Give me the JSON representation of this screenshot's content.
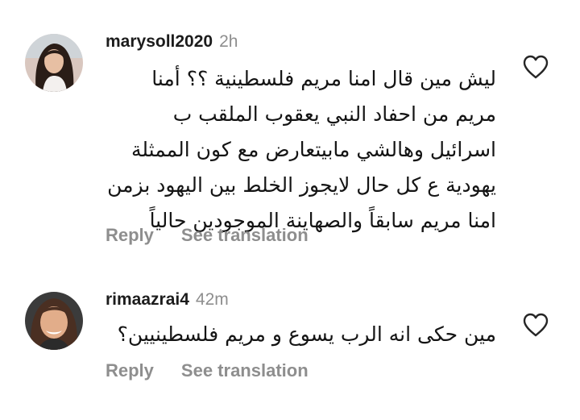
{
  "comments": [
    {
      "username": "marysoll2020",
      "time": "2h",
      "text": "ليش مين قال امنا مريم فلسطينية ؟؟ أمنا مريم من احفاد النبي يعقوب الملقب ب اسرائيل وهالشي مابيتعارض مع كون الممثلة يهودية ع كل حال لايجوز الخلط بين اليهود بزمن امنا مريم سابقاً والصهاينة الموجودين حالياً",
      "reply_label": "Reply",
      "translate_label": "See translation",
      "like_icon": "heart-outline-icon"
    },
    {
      "username": "rimaazrai4",
      "time": "42m",
      "text": "مين حكى انه الرب يسوع و مريم فلسطينيين؟",
      "reply_label": "Reply",
      "translate_label": "See translation",
      "like_icon": "heart-outline-icon"
    }
  ],
  "colors": {
    "text": "#141414",
    "secondary": "#8e8e8e",
    "background": "#ffffff"
  }
}
